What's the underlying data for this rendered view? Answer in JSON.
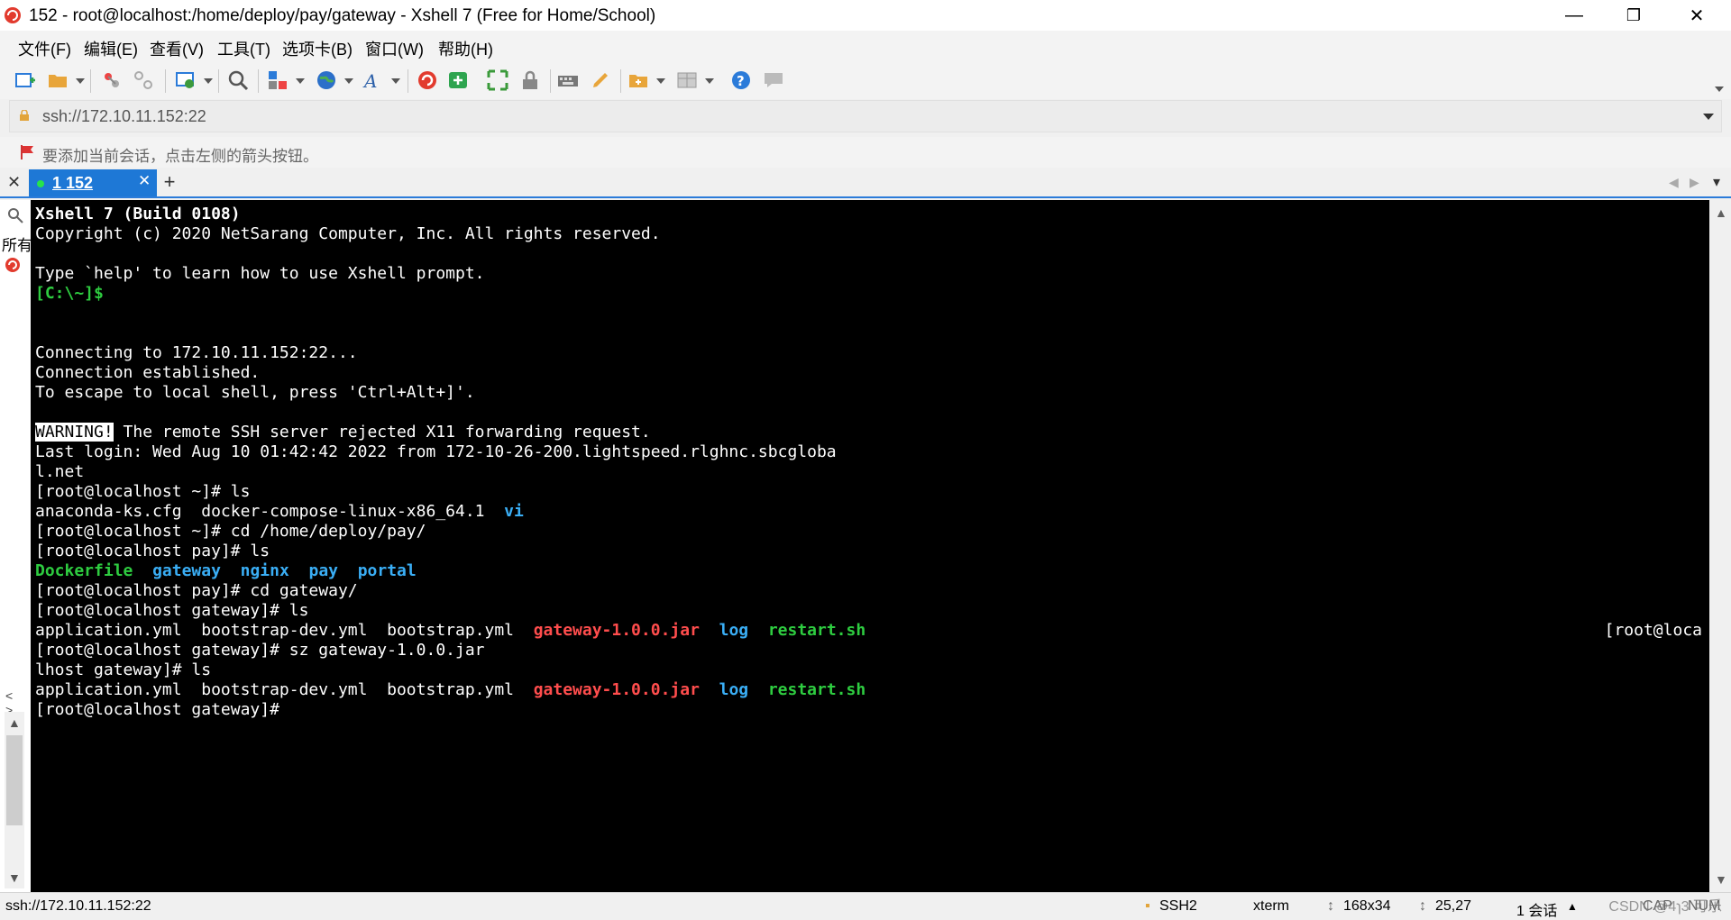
{
  "window": {
    "title": "152 - root@localhost:/home/deploy/pay/gateway - Xshell 7 (Free for Home/School)",
    "controls": {
      "minimize": "—",
      "maximize": "❐",
      "close": "✕"
    }
  },
  "menu": {
    "items": [
      "文件(F)",
      "编辑(E)",
      "查看(V)",
      "工具(T)",
      "选项卡(B)",
      "窗口(W)",
      "帮助(H)"
    ]
  },
  "address": {
    "url": "ssh://172.10.11.152:22"
  },
  "hint": {
    "text": "要添加当前会话，点击左侧的箭头按钮。"
  },
  "tabs": {
    "close_all": "✕",
    "active": {
      "label": "1 152",
      "close": "✕"
    },
    "add": "+",
    "nav_prev": "◀",
    "nav_next": "▶",
    "menu": "▾"
  },
  "side": {
    "label": "所有",
    "arrows": "< >"
  },
  "terminal": {
    "header1": "Xshell 7 (Build 0108)",
    "header2": "Copyright (c) 2020 NetSarang Computer, Inc. All rights reserved.",
    "help": "Type `help' to learn how to use Xshell prompt.",
    "local_prompt": "[C:\\~]$",
    "connecting": "Connecting to 172.10.11.152:22...",
    "established": "Connection established.",
    "escape": "To escape to local shell, press 'Ctrl+Alt+]'.",
    "warning_tag": "WARNING!",
    "warning_msg": " The remote SSH server rejected X11 forwarding request.",
    "last_login": "Last login: Wed Aug 10 01:42:42 2022 from 172-10-26-200.lightspeed.rlghnc.sbcgloba",
    "last_login_cont": "l.net",
    "cmd1": "[root@localhost ~]# ls",
    "ls1_file1": "anaconda-ks.cfg  docker-compose-linux-x86_64.1  ",
    "ls1_dir": "vi",
    "cmd2": "[root@localhost ~]# cd /home/deploy/pay/",
    "cmd3": "[root@localhost pay]# ls",
    "ls2_file": "Dockerfile",
    "ls2_dir1": "gateway",
    "ls2_dir2": "nginx",
    "ls2_dir3": "pay",
    "ls2_dir4": "portal",
    "cmd4": "[root@localhost pay]# cd gateway/",
    "cmd5": "[root@localhost gateway]# ls",
    "ls3_plain": "application.yml  bootstrap-dev.yml  bootstrap.yml  ",
    "ls3_jar": "gateway-1.0.0.jar",
    "ls3_log": "log",
    "ls3_sh": "restart.sh",
    "cmd6": "[root@localhost gateway]# sz gateway-1.0.0.jar",
    "cmd6_right": "[root@loca",
    "cmd7": "lhost gateway]# ls",
    "ls4_plain": "application.yml  bootstrap-dev.yml  bootstrap.yml  ",
    "ls4_jar": "gateway-1.0.0.jar",
    "ls4_log": "log",
    "ls4_sh": "restart.sh",
    "prompt_final": "[root@localhost gateway]# "
  },
  "status": {
    "url": "ssh://172.10.11.152:22",
    "protocol": "SSH2",
    "term": "xterm",
    "size": "168x34",
    "cursor": "25,27",
    "sessions": "1 会话",
    "cap": "CAP",
    "num": "NUM"
  },
  "watermark": "CSDN @4ɿ3 可乐"
}
